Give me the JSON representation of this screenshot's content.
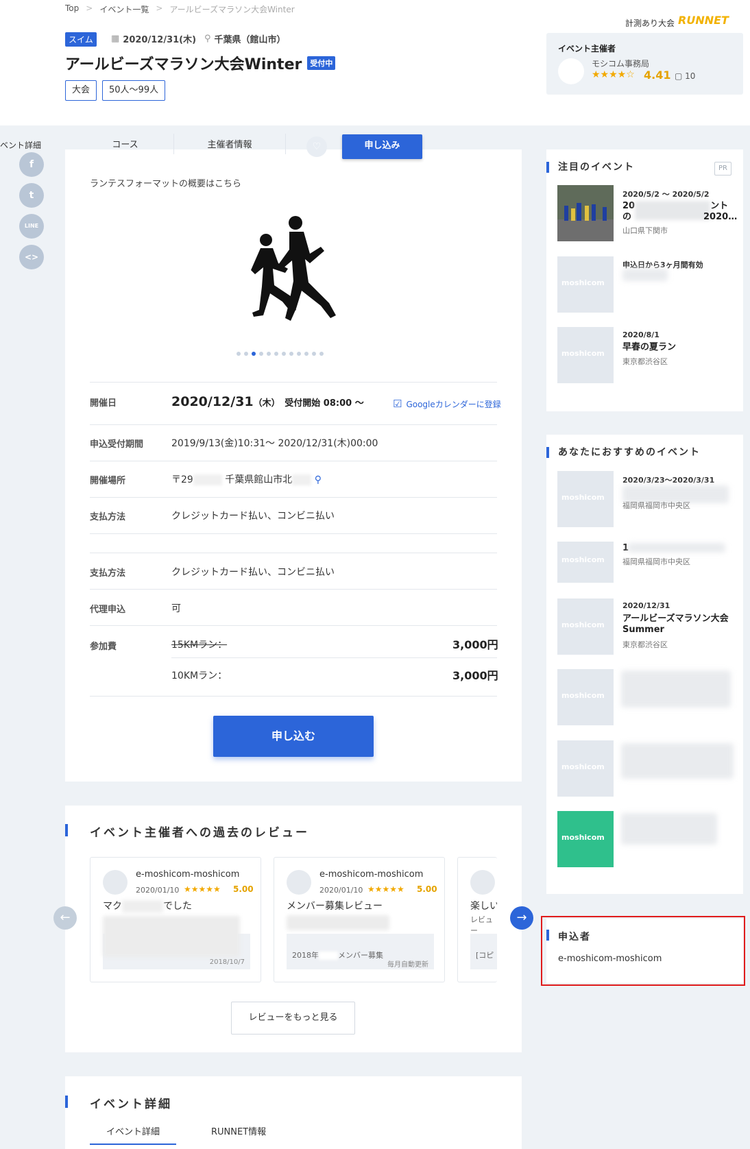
{
  "breadcrumb": {
    "top": "Top",
    "events": "イベント一覧",
    "current": "アールビーズマラソン大会Winter"
  },
  "event": {
    "category": "スイム",
    "date": "2020/12/31(木)",
    "location": "千葉県（館山市）",
    "title": "アールビーズマラソン大会Winter",
    "status": "受付中",
    "tags": [
      "大会",
      "50人〜99人"
    ]
  },
  "measure_label": "計測あり大会",
  "runnet_logo": {
    "a": "RUN",
    "b": "NET"
  },
  "organizer": {
    "label": "イベント主催者",
    "name": "モシコム事務局",
    "stars": "★★★★☆",
    "rating": "4.41",
    "comments": "10"
  },
  "side_nav": {
    "label": "ベント詳細",
    "social": [
      "f",
      "t",
      "LINE",
      "<>"
    ]
  },
  "tabs": {
    "course": "コース",
    "organizer": "主催者情報",
    "apply": "申し込み"
  },
  "overview_link": "ランテスフォーマットの概要はこちら",
  "carousel": {
    "count": 12,
    "active": 2
  },
  "info": {
    "date_label": "開催日",
    "date_value": "2020/12/31",
    "date_weekday": "（木）",
    "date_accept": "受付開始 08:00 〜",
    "gcal": "Googleカレンダーに登録",
    "period_label": "申込受付期間",
    "period_value": "2019/9/13(金)10:31〜 2020/12/31(木)00:00",
    "venue_label": "開催場所",
    "venue_value_a": "〒29",
    "venue_value_b": "千葉県館山市北",
    "pay_label": "支払方法",
    "pay_value": "クレジットカード払い、コンビニ払い",
    "pay2_label": "支払方法",
    "pay2_value": "クレジットカード払い、コンビニ払い",
    "proxy_label": "代理申込",
    "proxy_value": "可",
    "fee_label": "参加費",
    "fees": [
      {
        "name": "15KMラン：",
        "price": "3,000円"
      },
      {
        "name": "10KMラン：",
        "price": "3,000円"
      }
    ]
  },
  "apply_button": "申し込む",
  "reviews": {
    "title": "イベント主催者への過去のレビュー",
    "items": [
      {
        "name": "e-moshicom-moshicom",
        "date": "2020/01/10",
        "stars": "★★★★★",
        "score": "5.00",
        "title": "マク",
        "title2": "でした",
        "foot_l": "",
        "foot_r": "2018/10/7"
      },
      {
        "name": "e-moshicom-moshicom",
        "date": "2020/01/10",
        "stars": "★★★★★",
        "score": "5.00",
        "title": "メンバー募集レビュー",
        "foot_l": "2018年",
        "foot_l2": "メンバー募集",
        "foot_r": "毎月自動更新"
      },
      {
        "name": "",
        "date": "",
        "title": "楽しい",
        "sub": "レビュー",
        "foot_l": "[コピ"
      }
    ],
    "more": "レビューをもっと見る"
  },
  "details": {
    "title": "イベント詳細",
    "tab1": "イベント詳細",
    "tab2": "RUNNET情報"
  },
  "featured": {
    "title": "注目のイベント",
    "pr": "PR",
    "items": [
      {
        "date": "2020/5/2 〜 2020/5/2",
        "name": "20",
        "name_tail": "ント",
        "name2": "の",
        "name2_tail": "2020…",
        "loc": "山口県下関市"
      },
      {
        "date": "申込日から3ヶ月間有効",
        "name": "",
        "loc": ""
      },
      {
        "date": "2020/8/1",
        "name": "早春の夏ラン",
        "loc": "東京都渋谷区"
      }
    ]
  },
  "recommended": {
    "title": "あなたにおすすめのイベント",
    "items": [
      {
        "date": "2020/3/23〜2020/3/31",
        "name": "",
        "loc": "福岡県福岡市中央区"
      },
      {
        "date": "",
        "name": "1",
        "loc": "福岡県福岡市中央区"
      },
      {
        "date": "2020/12/31",
        "name": "アールビーズマラソン大会Summer",
        "loc": "東京都渋谷区"
      },
      {
        "date": "",
        "name": "",
        "loc": ""
      },
      {
        "date": "",
        "name": "",
        "loc": ""
      },
      {
        "date": "",
        "name": "",
        "loc": ""
      }
    ],
    "thumb_label": "moshicom"
  },
  "applicant": {
    "title": "申込者",
    "name": "e-moshicom-moshicom"
  },
  "colors": {
    "primary": "#2c65d9",
    "star": "#f2a900",
    "highlight": "#e01b1b",
    "bg": "#eef2f6"
  }
}
